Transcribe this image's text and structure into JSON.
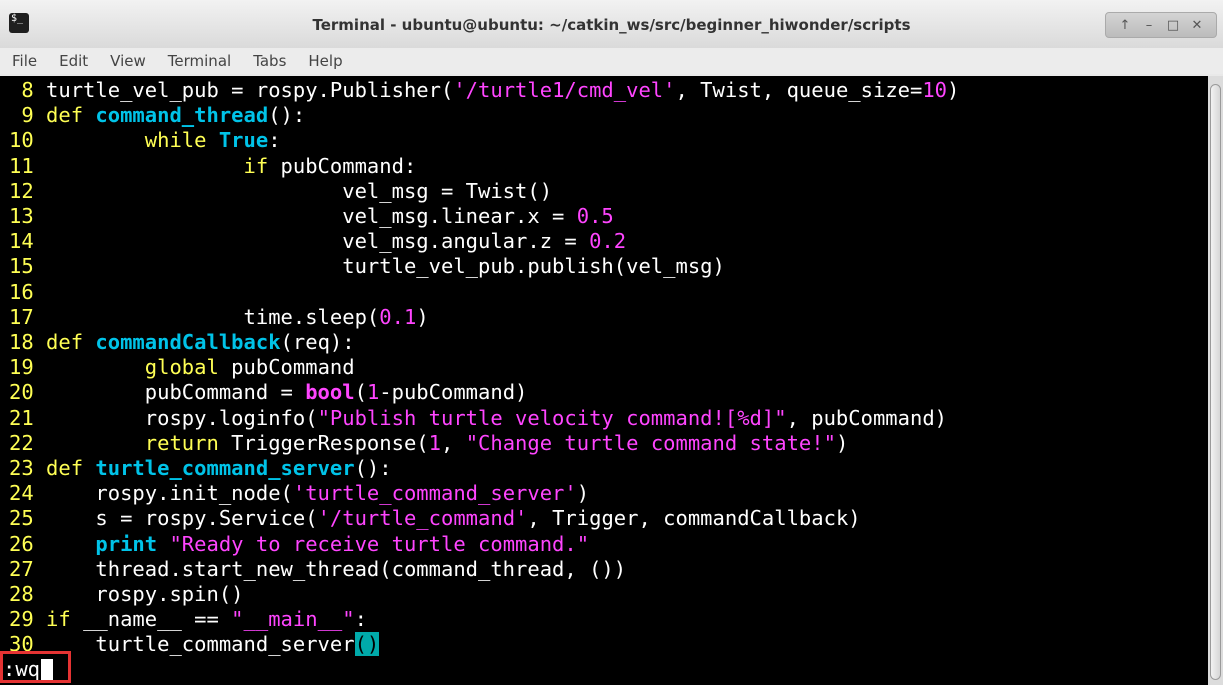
{
  "window": {
    "title": "Terminal - ubuntu@ubuntu: ~/catkin_ws/src/beginner_hiwonder/scripts",
    "icon": "terminal-icon",
    "controls": [
      "↑",
      "–",
      "□",
      "✕"
    ]
  },
  "menu": [
    "File",
    "Edit",
    "View",
    "Terminal",
    "Tabs",
    "Help"
  ],
  "colors": {
    "background": "#000000",
    "line_number": "#ffff54",
    "keyword": "#ffff54",
    "function_name": "#00c3e8",
    "string": "#ff45ff",
    "number": "#ff45ff",
    "highlight": "#00aaaa",
    "annotation_box": "#e53333"
  },
  "code": [
    {
      "n": " 8",
      "segs": [
        {
          "t": "turtle_vel_pub = rospy.Publisher(",
          "c": ""
        },
        {
          "t": "'/turtle1/cmd_vel'",
          "c": "str"
        },
        {
          "t": ", Twist, queue_size=",
          "c": ""
        },
        {
          "t": "10",
          "c": "num"
        },
        {
          "t": ")",
          "c": ""
        }
      ]
    },
    {
      "n": " 9",
      "segs": [
        {
          "t": "def ",
          "c": "kw"
        },
        {
          "t": "command_thread",
          "c": "fn"
        },
        {
          "t": "():",
          "c": ""
        }
      ]
    },
    {
      "n": "10",
      "segs": [
        {
          "t": "        while ",
          "c": "kw"
        },
        {
          "t": "True",
          "c": "fn"
        },
        {
          "t": ":",
          "c": ""
        }
      ]
    },
    {
      "n": "11",
      "segs": [
        {
          "t": "                if ",
          "c": "kw"
        },
        {
          "t": "pubCommand:",
          "c": ""
        }
      ]
    },
    {
      "n": "12",
      "segs": [
        {
          "t": "                        vel_msg = Twist()",
          "c": ""
        }
      ]
    },
    {
      "n": "13",
      "segs": [
        {
          "t": "                        vel_msg.linear.x = ",
          "c": ""
        },
        {
          "t": "0.5",
          "c": "num"
        }
      ]
    },
    {
      "n": "14",
      "segs": [
        {
          "t": "                        vel_msg.angular.z = ",
          "c": ""
        },
        {
          "t": "0.2",
          "c": "num"
        }
      ]
    },
    {
      "n": "15",
      "segs": [
        {
          "t": "                        turtle_vel_pub.publish(vel_msg)",
          "c": ""
        }
      ]
    },
    {
      "n": "16",
      "segs": []
    },
    {
      "n": "17",
      "segs": [
        {
          "t": "                time.sleep(",
          "c": ""
        },
        {
          "t": "0.1",
          "c": "num"
        },
        {
          "t": ")",
          "c": ""
        }
      ]
    },
    {
      "n": "18",
      "segs": [
        {
          "t": "def ",
          "c": "kw"
        },
        {
          "t": "commandCallback",
          "c": "fn"
        },
        {
          "t": "(req):",
          "c": ""
        }
      ]
    },
    {
      "n": "19",
      "segs": [
        {
          "t": "        global ",
          "c": "kw"
        },
        {
          "t": "pubCommand",
          "c": ""
        }
      ]
    },
    {
      "n": "20",
      "segs": [
        {
          "t": "        pubCommand = ",
          "c": ""
        },
        {
          "t": "bool",
          "c": "bi"
        },
        {
          "t": "(",
          "c": ""
        },
        {
          "t": "1",
          "c": "num"
        },
        {
          "t": "-pubCommand)",
          "c": ""
        }
      ]
    },
    {
      "n": "21",
      "segs": [
        {
          "t": "        rospy.loginfo(",
          "c": ""
        },
        {
          "t": "\"Publish turtle velocity command![%d]\"",
          "c": "str"
        },
        {
          "t": ", pubCommand)",
          "c": ""
        }
      ]
    },
    {
      "n": "22",
      "segs": [
        {
          "t": "        return ",
          "c": "kw"
        },
        {
          "t": "TriggerResponse(",
          "c": ""
        },
        {
          "t": "1",
          "c": "num"
        },
        {
          "t": ", ",
          "c": ""
        },
        {
          "t": "\"Change turtle command state!\"",
          "c": "str"
        },
        {
          "t": ")",
          "c": ""
        }
      ]
    },
    {
      "n": "23",
      "segs": [
        {
          "t": "def ",
          "c": "kw"
        },
        {
          "t": "turtle_command_server",
          "c": "fn"
        },
        {
          "t": "():",
          "c": ""
        }
      ]
    },
    {
      "n": "24",
      "segs": [
        {
          "t": "    rospy.init_node(",
          "c": ""
        },
        {
          "t": "'turtle_command_server'",
          "c": "str"
        },
        {
          "t": ")",
          "c": ""
        }
      ]
    },
    {
      "n": "25",
      "segs": [
        {
          "t": "    s = rospy.Service(",
          "c": ""
        },
        {
          "t": "'/turtle_command'",
          "c": "str"
        },
        {
          "t": ", Trigger, commandCallback)",
          "c": ""
        }
      ]
    },
    {
      "n": "26",
      "segs": [
        {
          "t": "    print ",
          "c": "fn"
        },
        {
          "t": "\"Ready to receive turtle command.\"",
          "c": "str"
        }
      ]
    },
    {
      "n": "27",
      "segs": [
        {
          "t": "    thread.start_new_thread(command_thread, ())",
          "c": ""
        }
      ]
    },
    {
      "n": "28",
      "segs": [
        {
          "t": "    rospy.spin()",
          "c": ""
        }
      ]
    },
    {
      "n": "29",
      "segs": [
        {
          "t": "if ",
          "c": "kw"
        },
        {
          "t": "__name__ == ",
          "c": ""
        },
        {
          "t": "\"__main__\"",
          "c": "str"
        },
        {
          "t": ":",
          "c": ""
        }
      ]
    },
    {
      "n": "30",
      "segs": [
        {
          "t": "    turtle_command_server",
          "c": ""
        },
        {
          "t": "()",
          "c": "hl"
        }
      ]
    }
  ],
  "command_line": ":wq"
}
